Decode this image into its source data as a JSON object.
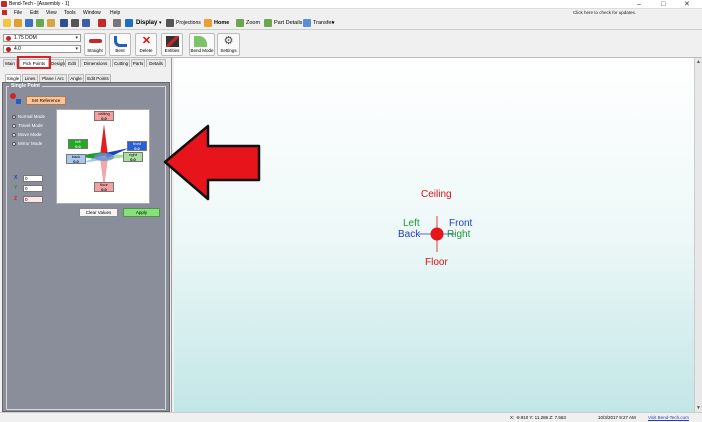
{
  "window": {
    "title": "Bend-Tech - [Assembly - 1]",
    "controls": [
      "–",
      "□",
      "✕"
    ]
  },
  "menu": [
    "File",
    "Edit",
    "View",
    "Tools",
    "Window",
    "Help"
  ],
  "update_text": "Click here to check for updates.",
  "quick_access": {
    "display": "Display",
    "projections": "Projections",
    "home": "Home",
    "zoom": "Zoom",
    "part_details": "Part Details",
    "transfer": "Transfer"
  },
  "ribbon": {
    "tube_select": "1.75 DOM",
    "die_select": "4.0",
    "buttons": [
      "Straight",
      "Bent",
      "Delete",
      "Entities",
      "Bend Mode",
      "Settings"
    ]
  },
  "tabs_main": [
    "Main",
    "Pick Points",
    "Design",
    "Edit",
    "Dimensions",
    "Cutting",
    "Parts",
    "Details"
  ],
  "tabs_sub": [
    "Single",
    "Lines",
    "Plane / Arc",
    "Angle",
    "Edit Points"
  ],
  "group": {
    "title": "Single Point",
    "set_reference": "Set Reference",
    "modes": [
      "Normal Mode",
      "Travel Mode",
      "Move Mode",
      "Mirror Mode"
    ],
    "selected_mode": "Normal Mode"
  },
  "orientation": {
    "ceiling": {
      "label": "ceiling",
      "value": "0.0"
    },
    "floor": {
      "label": "floor",
      "value": "0.0"
    },
    "left": {
      "label": "left",
      "value": "0.0"
    },
    "right": {
      "label": "right",
      "value": "0.0"
    },
    "front": {
      "label": "front",
      "value": "0.0"
    },
    "back": {
      "label": "back",
      "value": "0.0"
    }
  },
  "coords": {
    "x_label": "X",
    "y_label": "Y",
    "z_label": "Z",
    "x": "0",
    "y": "0",
    "z": "0"
  },
  "actions": {
    "clear": "Clear Values",
    "apply": "Apply"
  },
  "viewport": {
    "ceiling": "Ceiling",
    "floor": "Floor",
    "left": "Left",
    "right": "Right",
    "front": "Front",
    "back": "Back"
  },
  "status": {
    "coords": "X: -9.910  Y: 11.286  Z: 7.563",
    "datetime": "10/3/2017  9:27 AM",
    "link": "Visit Bend-Tech.com"
  },
  "colors": {
    "accent_red": "#e02020",
    "arrow_red": "#e8141c",
    "apply_green": "#88e07c",
    "panel_gray": "#8a8e9a"
  }
}
